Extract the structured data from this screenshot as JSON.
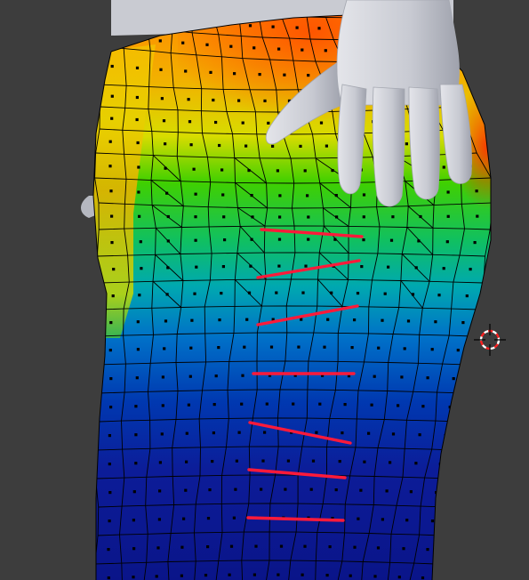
{
  "viewport": {
    "mode": "weight-paint",
    "background_color": "#3d3d3d"
  },
  "weight_colors": {
    "high": "#ff3a00",
    "orange": "#ff9a00",
    "yellow": "#e8e400",
    "green": "#22d400",
    "cyan": "#00b0b0",
    "mid_blue": "#0060d0",
    "low": "#0c1890"
  },
  "mesh": {
    "wire_color": "#000000",
    "vertex_color": "#000000"
  },
  "annotations": {
    "stroke_color": "#ff1a3a",
    "count": 7
  },
  "body": {
    "skin_color": "#c8cad2"
  },
  "cursor": {
    "name": "3d-cursor",
    "ring_color": "#ff2020"
  }
}
